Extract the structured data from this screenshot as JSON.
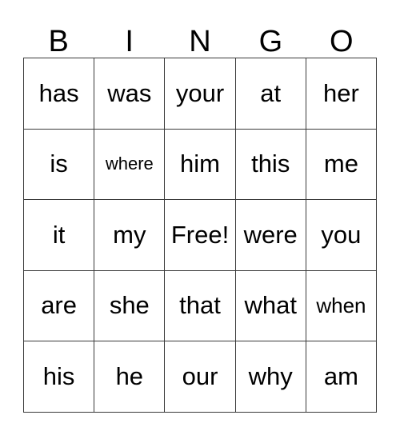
{
  "card": {
    "header": {
      "letters": [
        "B",
        "I",
        "N",
        "G",
        "O"
      ]
    },
    "grid": {
      "rows": [
        [
          {
            "text": "has",
            "size": "normal"
          },
          {
            "text": "was",
            "size": "normal"
          },
          {
            "text": "your",
            "size": "normal"
          },
          {
            "text": "at",
            "size": "normal"
          },
          {
            "text": "her",
            "size": "normal"
          }
        ],
        [
          {
            "text": "is",
            "size": "normal"
          },
          {
            "text": "where",
            "size": "small"
          },
          {
            "text": "him",
            "size": "normal"
          },
          {
            "text": "this",
            "size": "normal"
          },
          {
            "text": "me",
            "size": "normal"
          }
        ],
        [
          {
            "text": "it",
            "size": "normal"
          },
          {
            "text": "my",
            "size": "normal"
          },
          {
            "text": "Free!",
            "size": "normal"
          },
          {
            "text": "were",
            "size": "normal"
          },
          {
            "text": "you",
            "size": "normal"
          }
        ],
        [
          {
            "text": "are",
            "size": "normal"
          },
          {
            "text": "she",
            "size": "normal"
          },
          {
            "text": "that",
            "size": "normal"
          },
          {
            "text": "what",
            "size": "normal"
          },
          {
            "text": "when",
            "size": "medium"
          }
        ],
        [
          {
            "text": "his",
            "size": "normal"
          },
          {
            "text": "he",
            "size": "normal"
          },
          {
            "text": "our",
            "size": "normal"
          },
          {
            "text": "why",
            "size": "normal"
          },
          {
            "text": "am",
            "size": "normal"
          }
        ]
      ]
    },
    "colors": {
      "background": "#ffffff",
      "text": "#000000",
      "grid_line": "#3a3a3a"
    }
  }
}
